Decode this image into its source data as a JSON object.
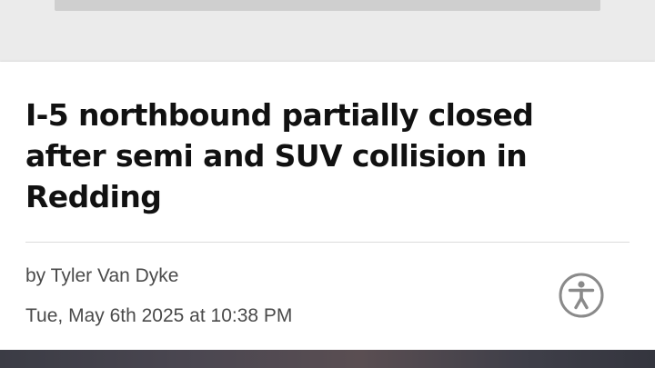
{
  "article": {
    "headline": "I-5 northbound partially closed after semi and SUV collision in Redding",
    "byline_prefix": "by",
    "author": "Tyler Van Dyke",
    "timestamp": "Tue, May 6th 2025 at 10:38 PM"
  },
  "accessibility_button": {
    "icon": "accessibility-icon",
    "color": "#8a8a8a"
  },
  "colors": {
    "page_background": "#ebebeb",
    "card_background": "#ffffff",
    "headline": "#111111",
    "meta_text": "#4a4a4a"
  }
}
